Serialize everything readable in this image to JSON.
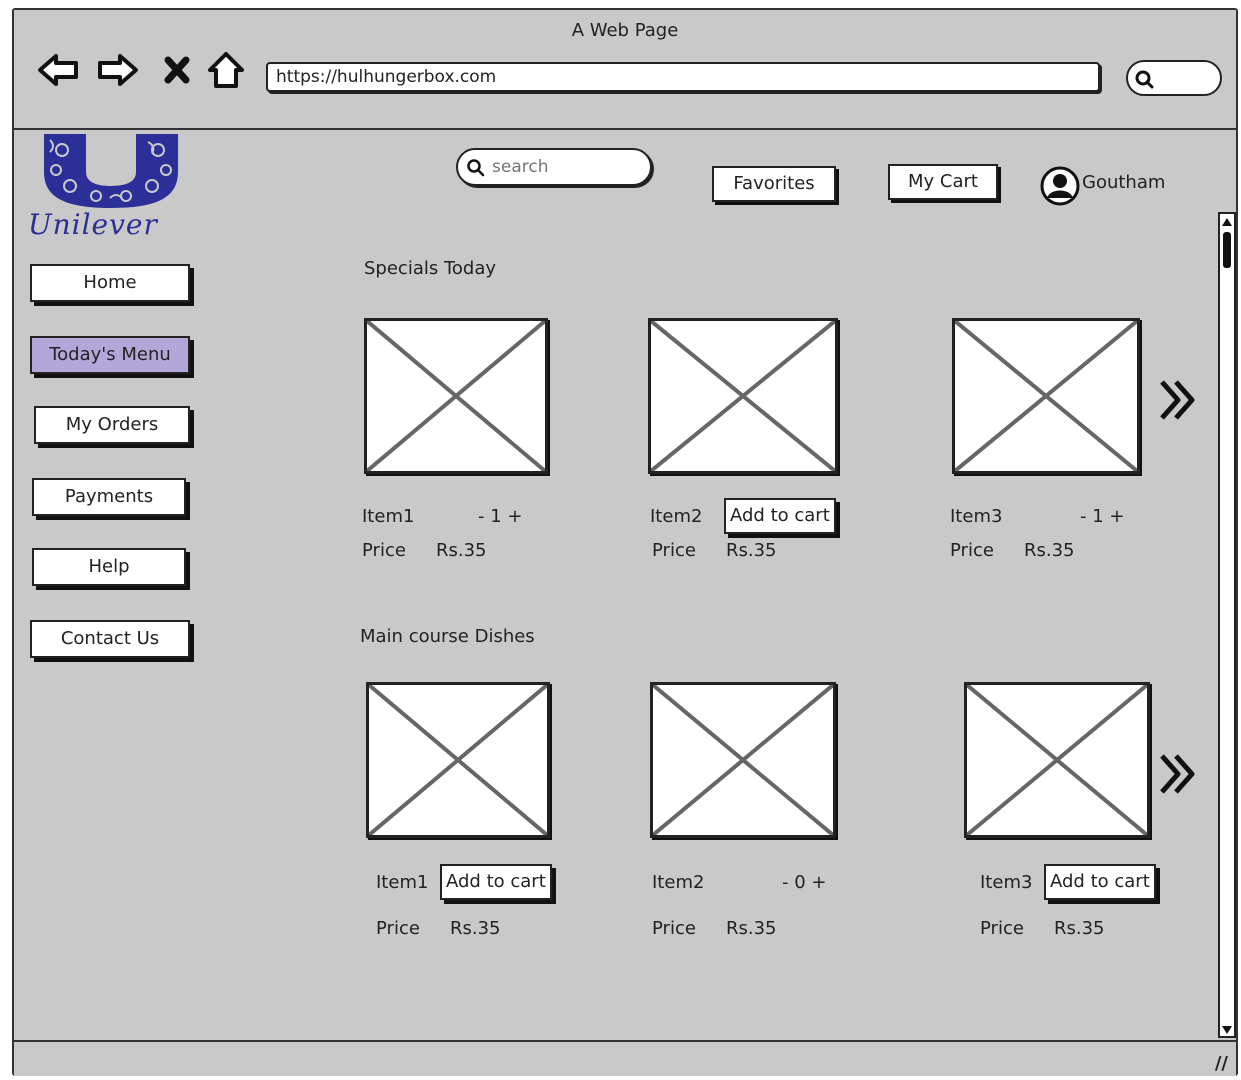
{
  "window": {
    "title": "A Web Page"
  },
  "browser": {
    "url": "https://hulhungerbox.com",
    "nav_icons": [
      "back-arrow-icon",
      "forward-arrow-icon",
      "close-x-icon",
      "home-icon"
    ],
    "search_icon": "search-icon"
  },
  "header": {
    "logo_text": "Unilever",
    "search_placeholder": "search",
    "favorites_label": "Favorites",
    "cart_label": "My Cart",
    "user_name": "Goutham"
  },
  "sidebar": {
    "items": [
      {
        "label": "Home"
      },
      {
        "label": "Today's Menu",
        "active": true
      },
      {
        "label": "My Orders"
      },
      {
        "label": "Payments"
      },
      {
        "label": "Help"
      },
      {
        "label": "Contact Us"
      }
    ]
  },
  "sections": [
    {
      "title": "Specials Today",
      "items": [
        {
          "name": "Item1",
          "control": "- 1 +",
          "price_label": "Price",
          "price": "Rs.35"
        },
        {
          "name": "Item2",
          "control": "Add to cart",
          "price_label": "Price",
          "price": "Rs.35"
        },
        {
          "name": "Item3",
          "control": "- 1 +",
          "price_label": "Price",
          "price": "Rs.35"
        }
      ]
    },
    {
      "title": "Main course Dishes",
      "items": [
        {
          "name": "Item1",
          "control": "Add to cart",
          "price_label": "Price",
          "price": "Rs.35"
        },
        {
          "name": "Item2",
          "control": "- 0 +",
          "price_label": "Price",
          "price": "Rs.35"
        },
        {
          "name": "Item3",
          "control": "Add to cart",
          "price_label": "Price",
          "price": "Rs.35"
        }
      ]
    }
  ],
  "colors": {
    "window_bg": "#c9c9c9",
    "active_nav": "#b3a6d9",
    "logo_blue": "#2b2f97"
  }
}
